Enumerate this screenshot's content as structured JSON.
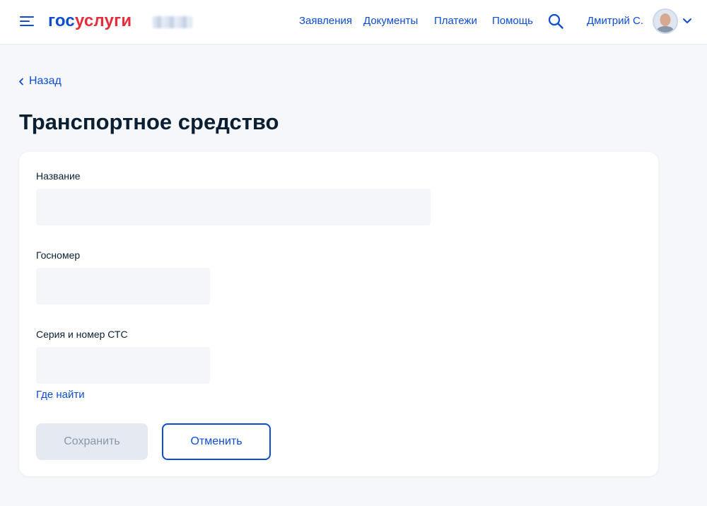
{
  "header": {
    "logo": {
      "part1": "гос",
      "part2": "услуги"
    },
    "nav": [
      "Заявления",
      "Документы",
      "Платежи",
      "Помощь"
    ],
    "user_name": "Дмитрий С.",
    "icons": [
      "menu-icon",
      "search-icon",
      "avatar",
      "chevron-down-icon"
    ]
  },
  "main": {
    "back_label": "Назад",
    "title": "Транспортное средство",
    "form": {
      "fields": [
        {
          "label": "Название",
          "value": "",
          "placeholder": ""
        },
        {
          "label": "Госномер",
          "value": "",
          "placeholder": ""
        },
        {
          "label": "Серия и номер СТС",
          "value": "",
          "placeholder": ""
        }
      ],
      "help_link": "Где найти",
      "save_label": "Сохранить",
      "cancel_label": "Отменить"
    }
  },
  "colors": {
    "accent": "#0d4cd3",
    "brand_red": "#e52d3c",
    "page_bg": "#f5f7fa",
    "field_bg": "#f5f6f9",
    "disabled_button_bg": "#e4e9f2"
  }
}
